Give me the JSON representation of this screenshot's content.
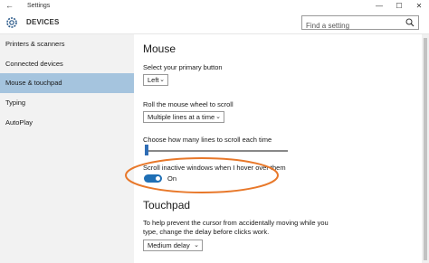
{
  "window": {
    "title": "Settings",
    "back_glyph": "←",
    "minimize_glyph": "—",
    "maximize_glyph": "☐",
    "close_glyph": "✕"
  },
  "header": {
    "section": "DEVICES",
    "search_placeholder": "Find a setting",
    "icon": "gear-icon"
  },
  "sidebar": {
    "items": [
      {
        "label": "Printers & scanners"
      },
      {
        "label": "Connected devices"
      },
      {
        "label": "Mouse & touchpad",
        "active": true
      },
      {
        "label": "Typing"
      },
      {
        "label": "AutoPlay"
      }
    ]
  },
  "mouse": {
    "heading": "Mouse",
    "primary_button_label": "Select your primary button",
    "primary_button_value": "Left",
    "wheel_label": "Roll the mouse wheel to scroll",
    "wheel_value": "Multiple lines at a time",
    "lines_label": "Choose how many lines to scroll each time",
    "scroll_inactive_label": "Scroll inactive windows when I hover over them",
    "scroll_inactive_state": "On"
  },
  "touchpad": {
    "heading": "Touchpad",
    "desc_line1": "To help prevent the cursor from accidentally moving while you",
    "desc_line2": "type, change the delay before clicks work.",
    "delay_value": "Medium delay"
  },
  "colors": {
    "active_nav": "#a5c4de",
    "toggle_on": "#1f6fb5",
    "highlight_ellipse": "#e8782a",
    "sidebar_bg": "#f2f2f2"
  }
}
